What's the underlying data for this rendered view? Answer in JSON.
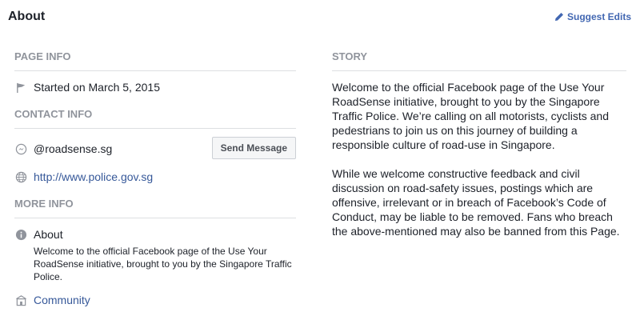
{
  "header": {
    "title": "About",
    "suggest_edits_label": "Suggest Edits"
  },
  "page_info": {
    "heading": "PAGE INFO",
    "started": "Started on March 5, 2015"
  },
  "contact_info": {
    "heading": "CONTACT INFO",
    "messenger_handle": "@roadsense.sg",
    "send_message_label": "Send Message",
    "website": "http://www.police.gov.sg"
  },
  "more_info": {
    "heading": "MORE INFO",
    "about_label": "About",
    "about_text": "Welcome to the official Facebook page of the Use Your RoadSense initiative, brought to you by the Singapore Traffic Police.",
    "category": "Community"
  },
  "story": {
    "heading": "STORY",
    "paragraphs": [
      "Welcome to the official Facebook page of the Use Your RoadSense initiative, brought to you by the Singapore Traffic Police. We’re calling on all motorists, cyclists and pedestrians to join us on this journey of building a responsible culture of road-use in Singapore.",
      "While we welcome constructive feedback and civil discussion on road-safety issues, postings which are offensive, irrelevant or in breach of Facebook’s Code of Conduct, may be liable to be removed. Fans who breach the above-mentioned may also be banned from this Page."
    ]
  },
  "colors": {
    "link": "#365899",
    "accent": "#4267b2",
    "muted": "#90949c"
  }
}
